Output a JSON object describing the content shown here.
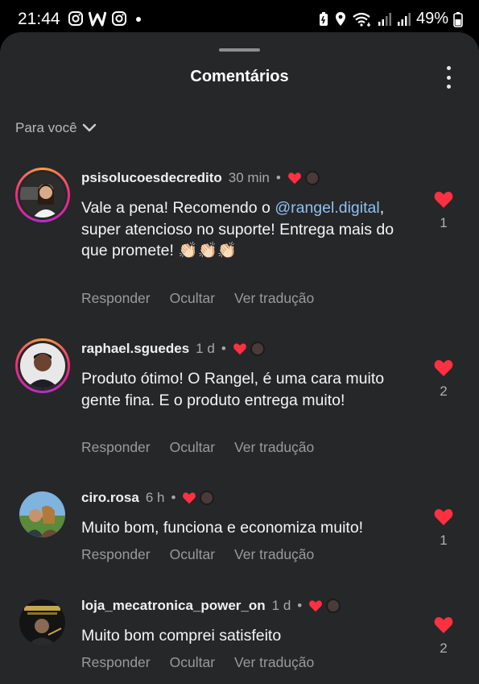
{
  "status_bar": {
    "time": "21:44",
    "left_icons": [
      "instagram-icon",
      "w-app-icon",
      "instagram-icon",
      "dot-icon"
    ],
    "right_icons": [
      "battery-saver-icon",
      "location-icon",
      "wifi-icon",
      "signal-icon",
      "signal-icon"
    ],
    "battery": "49%"
  },
  "header": {
    "title": "Comentários",
    "menu_icon": "more-vertical-icon"
  },
  "filter": {
    "label": "Para você",
    "icon": "chevron-down-icon"
  },
  "colors": {
    "background": "#262729",
    "like_red": "#ff3040",
    "mention_blue": "#8ec2f2",
    "muted_text": "#9a9a9a"
  },
  "comments": [
    {
      "username": "psisolucoesdecredito",
      "time": "30 min",
      "dot": "•",
      "text_before": "Vale a pena! Recomendo o ",
      "mention": "@rangel.digital",
      "text_after": ", super atencioso no suporte! Entrega mais do que promete! 👏🏻👏🏻👏🏻",
      "actions": [
        "Responder",
        "Ocultar",
        "Ver tradução"
      ],
      "likes": "1",
      "story_ring": true
    },
    {
      "username": "raphael.sguedes",
      "time": "1 d",
      "dot": "•",
      "text_before": "Produto ótimo! O Rangel, é uma cara muito gente fina. E o produto entrega muito!",
      "mention": "",
      "text_after": "",
      "actions": [
        "Responder",
        "Ocultar",
        "Ver tradução"
      ],
      "likes": "2",
      "story_ring": true
    },
    {
      "username": "ciro.rosa",
      "time": "6 h",
      "dot": "•",
      "text_before": "Muito bom, funciona e economiza muito!",
      "mention": "",
      "text_after": "",
      "actions": [
        "Responder",
        "Ocultar",
        "Ver tradução"
      ],
      "likes": "1",
      "story_ring": false
    },
    {
      "username": "loja_mecatronica_power_on",
      "time": "1 d",
      "dot": "•",
      "text_before": "Muito bom comprei satisfeito",
      "mention": "",
      "text_after": "",
      "actions": [
        "Responder",
        "Ocultar",
        "Ver tradução"
      ],
      "likes": "2",
      "story_ring": false
    }
  ]
}
